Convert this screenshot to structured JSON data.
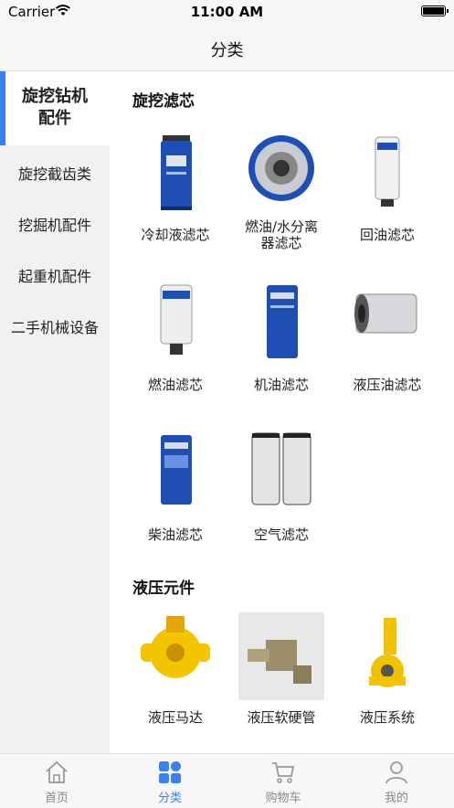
{
  "status_bar": {
    "carrier": "Carrier",
    "time": "11:00 AM"
  },
  "navbar": {
    "title": "分类"
  },
  "sidebar": {
    "items": [
      {
        "label": "旋挖钻机\n配件",
        "active": true
      },
      {
        "label": "旋挖截齿类"
      },
      {
        "label": "挖掘机配件"
      },
      {
        "label": "起重机配件"
      },
      {
        "label": "二手机械设备"
      }
    ]
  },
  "sections": [
    {
      "title": "旋挖滤芯",
      "items": [
        {
          "label": "冷却液滤芯",
          "icon": "blue-canister-filter-image"
        },
        {
          "label": "燃油/水分离\n器滤芯",
          "icon": "filter-top-view-image"
        },
        {
          "label": "回油滤芯",
          "icon": "xcmg-white-filter-image"
        },
        {
          "label": "燃油滤芯",
          "icon": "xcmg-fuel-filter-image"
        },
        {
          "label": "机油滤芯",
          "icon": "xcmg-oil-filter-image"
        },
        {
          "label": "液压油滤芯",
          "icon": "hydraulic-oil-filter-image"
        },
        {
          "label": "柴油滤芯",
          "icon": "xcmg-diesel-filter-image"
        },
        {
          "label": "空气滤芯",
          "icon": "air-filter-pair-image"
        }
      ]
    },
    {
      "title": "液压元件",
      "items": [
        {
          "label": "液压马达",
          "icon": "yellow-hydraulic-motor-image"
        },
        {
          "label": "液压软硬管",
          "icon": "hose-fitting-image"
        },
        {
          "label": "液压系统",
          "icon": "yellow-cylinder-joint-image"
        }
      ]
    }
  ],
  "tabbar": {
    "items": [
      {
        "label": "首页",
        "icon": "home-icon"
      },
      {
        "label": "分类",
        "icon": "category-icon",
        "active": true
      },
      {
        "label": "购物车",
        "icon": "cart-icon"
      },
      {
        "label": "我的",
        "icon": "profile-icon"
      }
    ]
  },
  "colors": {
    "accent": "#3b80ee",
    "sidebar_bg": "#f1f1f4",
    "bar_bg": "#f7f7f7"
  }
}
